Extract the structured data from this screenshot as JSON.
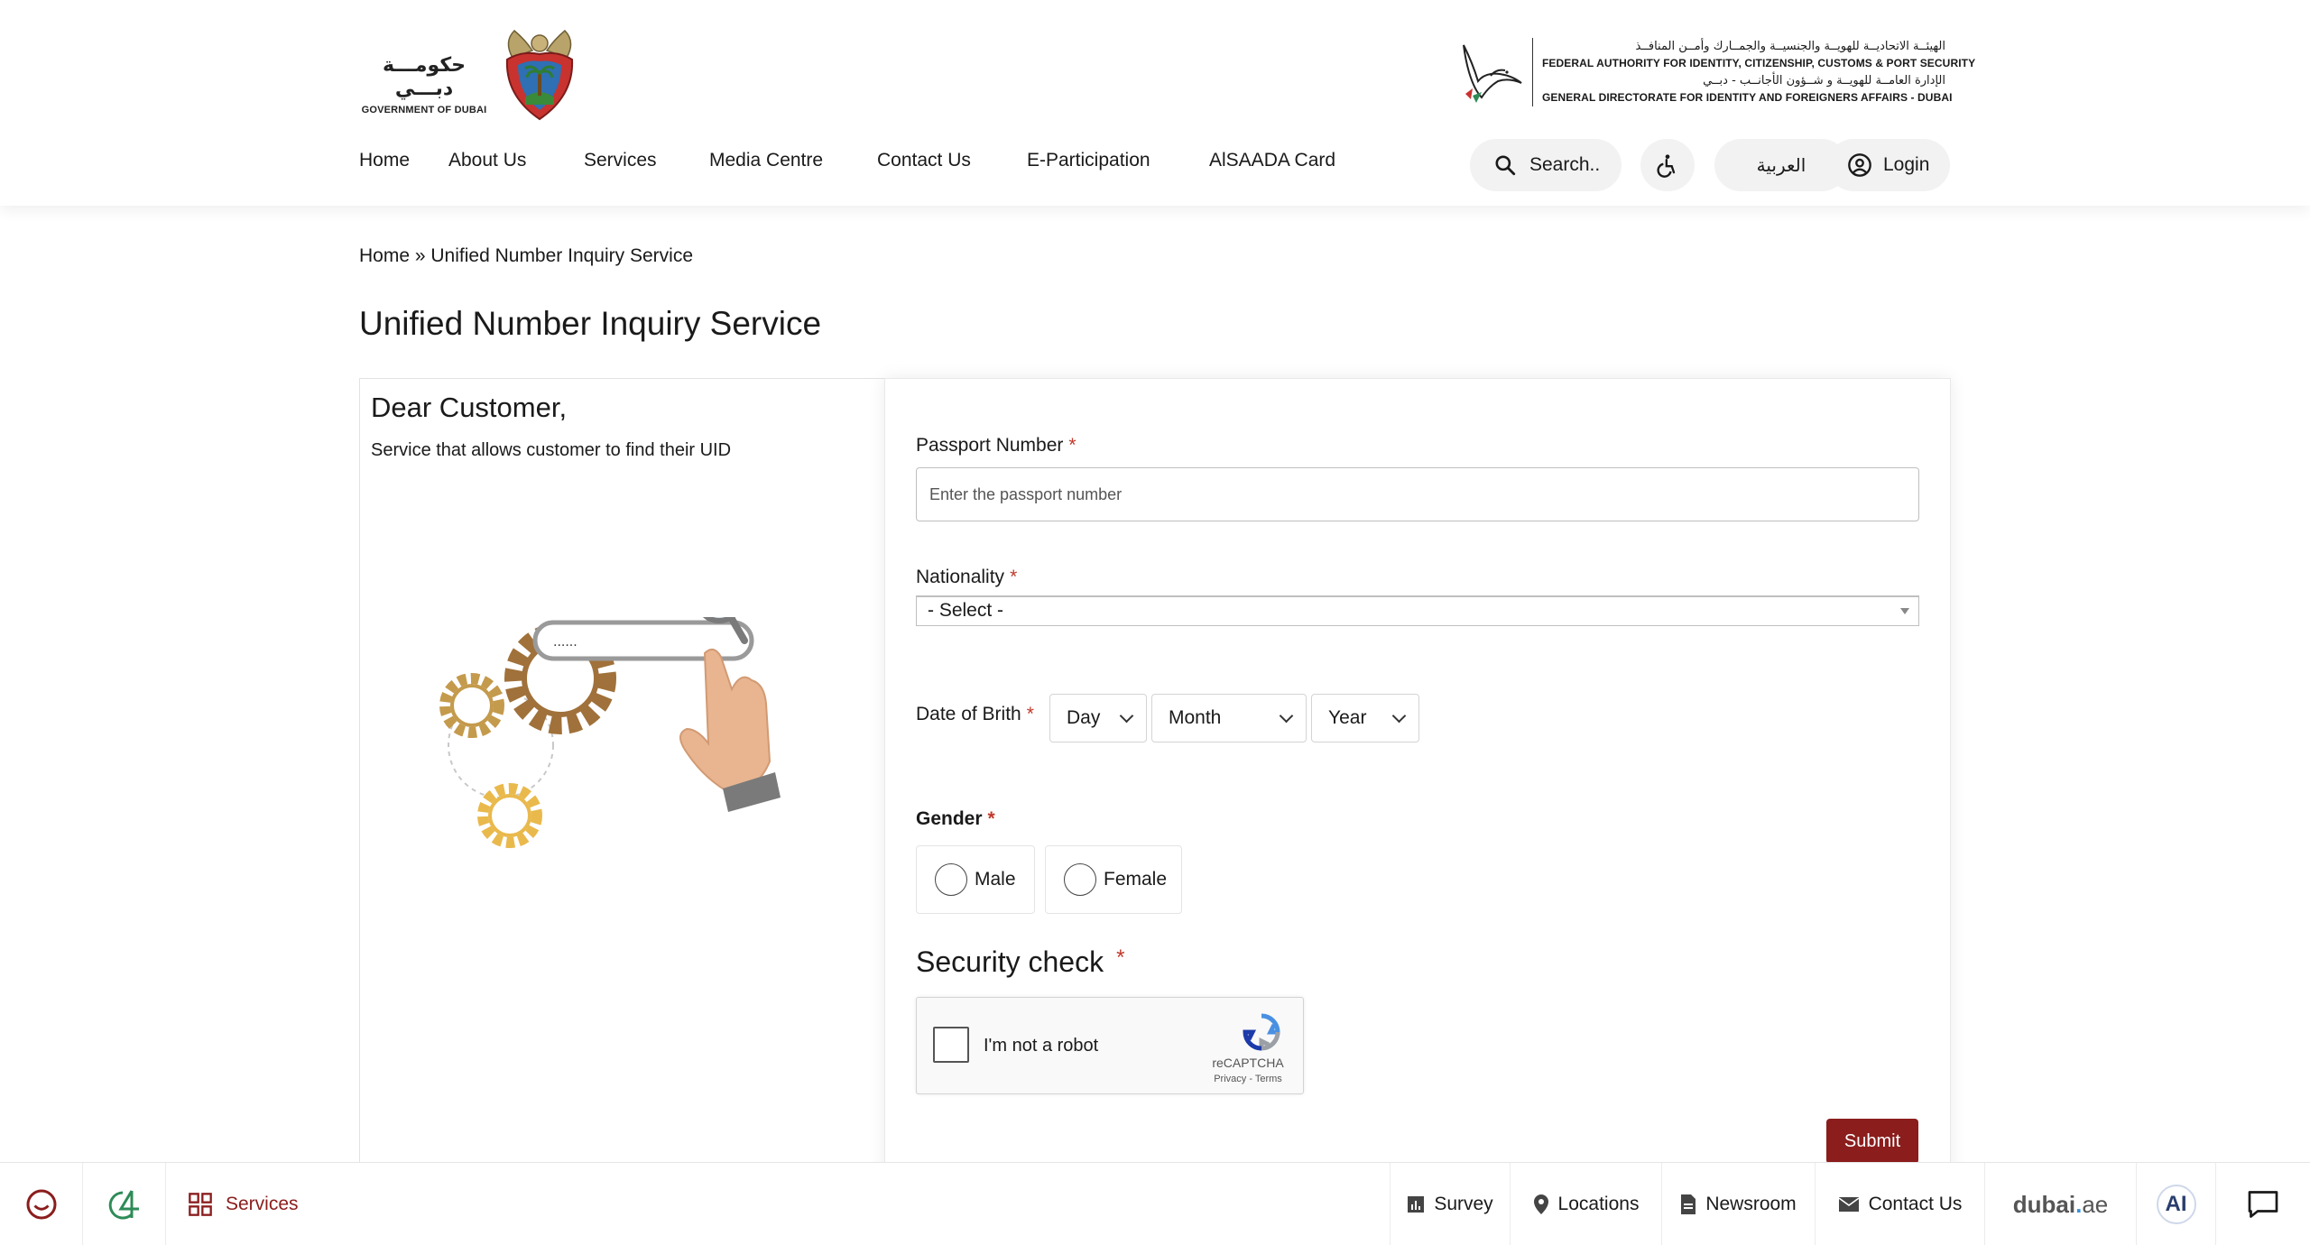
{
  "header": {
    "gov_logo": {
      "arabic": "حكومـــة دبـــي",
      "english": "GOVERNMENT OF DUBAI"
    },
    "authority_logo": {
      "line1_ar": "الهيئــة الاتحاديــة للهويــة والجنسيــة والجمــارك وأمــن المنافــذ",
      "line2_en": "FEDERAL AUTHORITY FOR IDENTITY, CITIZENSHIP, CUSTOMS & PORT SECURITY",
      "line3_ar": "الإدارة العامــة للهويــة و شــؤون الأجانــب - دبــي",
      "line4_en": "GENERAL DIRECTORATE FOR IDENTITY AND FOREIGNERS AFFAIRS - DUBAI"
    },
    "nav": [
      "Home",
      "About Us",
      "Services",
      "Media Centre",
      "Contact Us",
      "E-Participation",
      "AlSAADA Card"
    ],
    "search_label": "Search..",
    "language_label": "العربية",
    "login_label": "Login"
  },
  "breadcrumb": {
    "home": "Home",
    "separator": " » ",
    "current": "Unified Number Inquiry Service"
  },
  "page_title": "Unified Number Inquiry Service",
  "intro": {
    "greeting": "Dear Customer,",
    "description": "Service that allows customer to find their UID",
    "illustration_text": "......"
  },
  "form": {
    "passport": {
      "label": "Passport Number",
      "placeholder": "Enter the passport number",
      "value": ""
    },
    "nationality": {
      "label": "Nationality",
      "selected": "- Select -"
    },
    "dob": {
      "label": "Date of Brith",
      "day": "Day",
      "month": "Month",
      "year": "Year"
    },
    "gender": {
      "label": "Gender",
      "options": [
        "Male",
        "Female"
      ]
    },
    "security": {
      "label": "Security check",
      "recaptcha_text": "I'm not a robot",
      "recaptcha_brand": "reCAPTCHA",
      "recaptcha_terms": "Privacy - Terms"
    },
    "required_mark": "*",
    "submit_label": "Submit"
  },
  "footer": {
    "services": "Services",
    "survey": "Survey",
    "locations": "Locations",
    "newsroom": "Newsroom",
    "contact": "Contact Us",
    "dubai_brand_1": "dubai",
    "dubai_brand_dot": ".",
    "dubai_brand_2": "ae",
    "ai": "AI"
  },
  "colors": {
    "accent": "#8b1d1d",
    "required": "#c0392b",
    "text": "#1a1a1a"
  }
}
